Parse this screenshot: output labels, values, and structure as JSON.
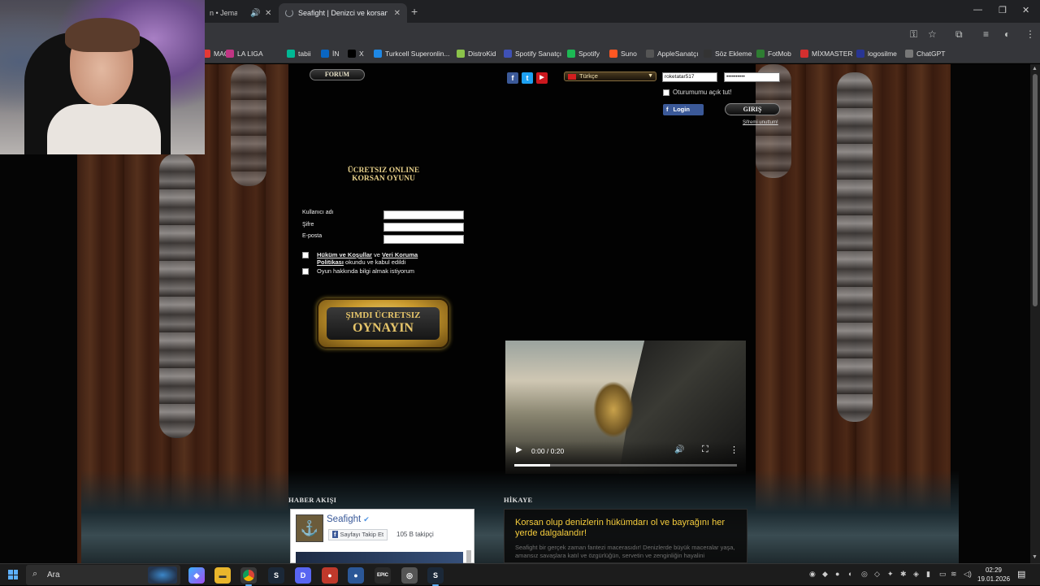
{
  "browser": {
    "tabs": [
      {
        "title": "n • Jemal",
        "active": false
      },
      {
        "title": "Seafight | Denizci ve korsanlar",
        "active": true
      }
    ],
    "bookmarks": [
      {
        "label": "MAÇ",
        "color": "#e53935"
      },
      {
        "label": "LA LIGA",
        "color": "#c13584"
      },
      {
        "label": "tabii",
        "color": "#00b894"
      },
      {
        "label": "İN",
        "color": "#0a66c2"
      },
      {
        "label": "X",
        "color": "#000000"
      },
      {
        "label": "Turkcell Superonlin...",
        "color": "#1e88e5"
      },
      {
        "label": "DistroKid",
        "color": "#8bc34a"
      },
      {
        "label": "Spotify Sanatçı",
        "color": "#3f51b5"
      },
      {
        "label": "Spotify",
        "color": "#1db954"
      },
      {
        "label": "Suno",
        "color": "#ff5722"
      },
      {
        "label": "AppleSanatçı",
        "color": "#555555"
      },
      {
        "label": "Söz Ekleme",
        "color": "#333333"
      },
      {
        "label": "FotMob",
        "color": "#2e7d32"
      },
      {
        "label": "MİXMASTER",
        "color": "#d32f2f"
      },
      {
        "label": "logosilme",
        "color": "#283593"
      },
      {
        "label": "ChatGPT",
        "color": "#777777"
      }
    ]
  },
  "site": {
    "forum_label": "FORUM",
    "social": [
      "f",
      "t",
      "▶"
    ],
    "language": "Türkçe",
    "header_login": {
      "username_value": "roketatar517",
      "password_value": "••••••••••",
      "remember_label": "Oturumumu açık tut!",
      "fb_login_label": "Login",
      "login_button": "GIRIŞ",
      "forgot_label": "Şifremi unuttum!"
    },
    "headline_line1": "ÜCRETSIZ ONLINE",
    "headline_line2": "KORSAN OYUNU",
    "register": {
      "username_label": "Kullanıcı adı",
      "password_label": "Şifre",
      "email_label": "E-posta",
      "terms_link1": "Hüküm ve Koşullar",
      "terms_and": " ve ",
      "terms_link2": "Veri Koruma",
      "terms_link2b": "Politikası",
      "terms_suffix": " okundu ve kabul edildi",
      "newsletter_label": "Oyun hakkında bilgi almak istiyorum"
    },
    "play_line1": "ŞIMDI ÜCRETSIZ",
    "play_line2": "OYNAYIN",
    "video": {
      "time": "0:00 / 0:20",
      "progress": 0.16
    },
    "news_title": "HABER AKIŞI",
    "facebook": {
      "page_name": "Seafight",
      "follow_label": "Sayfayı Takip Et",
      "followers": "105 B takipçi"
    },
    "story_title": "HİKAYE",
    "story_headline": "Korsan olup denizlerin hükümdarı ol ve bayrağını her yerde dalgalandır!",
    "story_body": "Seafight bir gerçek zaman fantezi macerasıdır! Denizlerde büyük maceralar yaşa, amansız savaşlara katıl ve özgürlüğün, servetin ve zenginliğin hayalini"
  },
  "taskbar": {
    "search_label": "Ara",
    "time": "02:29",
    "date": "19.01.2026"
  }
}
